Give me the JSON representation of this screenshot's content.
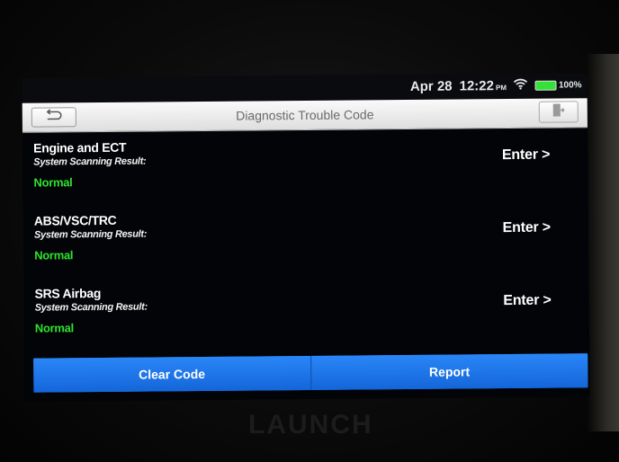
{
  "status_bar": {
    "date": "Apr 28",
    "time": "12:22",
    "ampm": "PM",
    "wifi_icon": "wifi-icon",
    "battery_percent": "100%",
    "battery_color": "#35e23a"
  },
  "header": {
    "title": "Diagnostic Trouble Code",
    "back_icon": "back-arrow-icon",
    "exit_icon": "exit-icon"
  },
  "systems": [
    {
      "name": "Engine and ECT",
      "subtitle": "System Scanning Result:",
      "status": "Normal",
      "action": "Enter >"
    },
    {
      "name": "ABS/VSC/TRC",
      "subtitle": "System Scanning Result:",
      "status": "Normal",
      "action": "Enter >"
    },
    {
      "name": "SRS Airbag",
      "subtitle": "System Scanning Result:",
      "status": "Normal",
      "action": "Enter >"
    }
  ],
  "footer": {
    "clear_code_label": "Clear Code",
    "report_label": "Report",
    "accent_color": "#1a78ee"
  },
  "device": {
    "brand": "LAUNCH"
  }
}
